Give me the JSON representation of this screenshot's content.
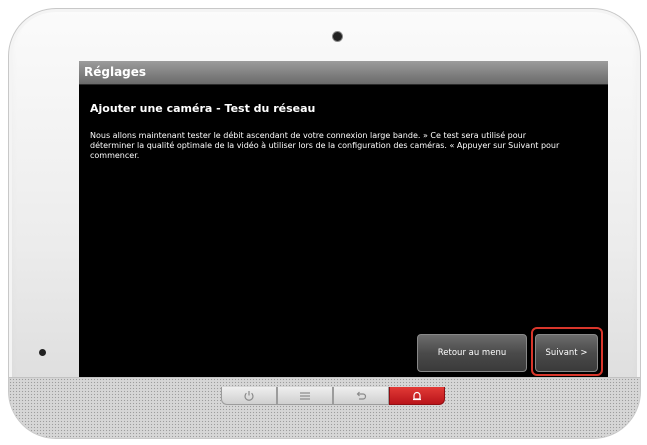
{
  "screen": {
    "title": "Réglages",
    "heading": "Ajouter une caméra - Test du réseau",
    "body": "Nous allons maintenant tester le débit ascendant de votre connexion large bande. » Ce test sera utilisé pour déterminer la qualité optimale de la vidéo à utiliser lors de la configuration des caméras. « Appuyer sur Suivant pour commencer.",
    "back_label": "Retour au menu",
    "next_label": "Suivant >"
  },
  "hardware_buttons": [
    {
      "icon": "power-icon"
    },
    {
      "icon": "menu-icon"
    },
    {
      "icon": "back-arrow-icon"
    },
    {
      "icon": "alarm-icon",
      "color": "#d2232a"
    }
  ],
  "colors": {
    "screen_bg": "#000000",
    "title_bar": "#7a7a7a",
    "highlight": "#d9362b"
  }
}
